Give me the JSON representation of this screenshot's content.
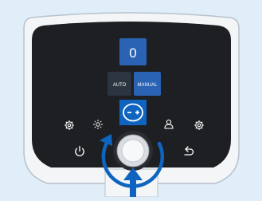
{
  "display": {
    "value": "0"
  },
  "mode_buttons": [
    {
      "label": "AUTO",
      "active": false
    },
    {
      "label": "MANUAL",
      "active": true
    }
  ],
  "icons": {
    "left_row": [
      "gear-icon",
      "sun-icon"
    ],
    "center": "minus-plus-icon",
    "right_row": [
      "person-icon",
      "gear-icon"
    ],
    "bottom_left": "power-icon",
    "bottom_right": "undo-arrow-icon",
    "knob": "rotary-knob",
    "rotation_hint": "rotate-arrow-icon",
    "press_hint": "press-arrow-icon"
  },
  "colors": {
    "background": "#dfeef8",
    "device_frame": "#f3f5f7",
    "panel": "#1e1f22",
    "accent_blue": "#2a63b4",
    "highlight_blue": "#0f64bf"
  }
}
